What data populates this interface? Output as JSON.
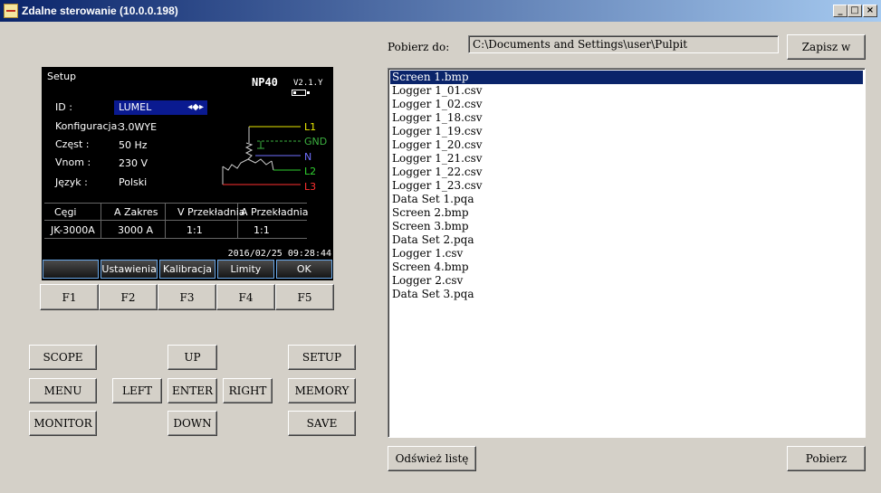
{
  "window": {
    "title": "Zdalne sterowanie (10.0.0.198)",
    "controls": {
      "minimize": "_",
      "maximize": "□",
      "close": "×"
    }
  },
  "device_screen": {
    "title": "Setup",
    "model": "NP40",
    "version": "V2.1.Y",
    "fields": [
      {
        "label": "ID :",
        "value": "LUMEL"
      },
      {
        "label": "Konfiguracja:",
        "value": "3.0WYE"
      },
      {
        "label": "Częst :",
        "value": "50 Hz"
      },
      {
        "label": "Vnom :",
        "value": "230 V"
      },
      {
        "label": "Język :",
        "value": "Polski"
      }
    ],
    "id_arrows": "◂◆▸",
    "wiring_labels": [
      "L1",
      "GND",
      "N",
      "L2",
      "L3"
    ],
    "wiring_colors": [
      "#e8e800",
      "#3cb040",
      "#7070ff",
      "#30d030",
      "#ff3030"
    ],
    "table": {
      "headers": [
        "Cęgi",
        "A Zakres",
        "V Przekładnia",
        "A Przekładnia"
      ],
      "row": [
        "JK-3000A",
        "3000 A",
        "1:1",
        "1:1"
      ]
    },
    "datetime": "2016/02/25 09:28:44",
    "softkeys": [
      "",
      "Ustawienia",
      "Kalibracja",
      "Limity",
      "OK"
    ]
  },
  "function_keys": [
    "F1",
    "F2",
    "F3",
    "F4",
    "F5"
  ],
  "control_buttons": {
    "scope": "SCOPE",
    "menu": "MENU",
    "monitor": "MONITOR",
    "left": "LEFT",
    "up": "UP",
    "enter": "ENTER",
    "down": "DOWN",
    "right": "RIGHT",
    "setup": "SETUP",
    "memory": "MEMORY",
    "save": "SAVE"
  },
  "download": {
    "label": "Pobierz do:",
    "path": "C:\\Documents and Settings\\user\\Pulpit",
    "save_to_button": "Zapisz w",
    "refresh_button": "Odśwież listę",
    "download_button": "Pobierz"
  },
  "files": [
    "Screen 1.bmp",
    "Logger 1_01.csv",
    "Logger 1_02.csv",
    "Logger 1_18.csv",
    "Logger 1_19.csv",
    "Logger 1_20.csv",
    "Logger 1_21.csv",
    "Logger 1_22.csv",
    "Logger 1_23.csv",
    "Data Set 1.pqa",
    "Screen 2.bmp",
    "Screen 3.bmp",
    "Data Set 2.pqa",
    "Logger 1.csv",
    "Screen 4.bmp",
    "Logger 2.csv",
    "Data Set 3.pqa"
  ],
  "selected_file": "Screen 1.bmp"
}
